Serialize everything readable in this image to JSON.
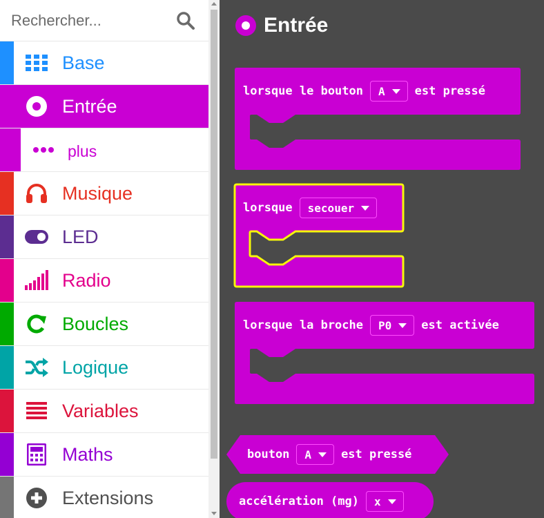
{
  "search": {
    "placeholder": "Rechercher..."
  },
  "categories": [
    {
      "label": "Base",
      "color": "#1e90ff",
      "icon": "grid-icon"
    },
    {
      "label": "Entrée",
      "color": "#c900d3",
      "icon": "target-icon"
    },
    {
      "label": "plus",
      "color": "#c900d3",
      "icon": "more-dots-icon"
    },
    {
      "label": "Musique",
      "color": "#e63022",
      "icon": "headphones-icon"
    },
    {
      "label": "LED",
      "color": "#5c2d91",
      "icon": "toggle-icon"
    },
    {
      "label": "Radio",
      "color": "#e3008c",
      "icon": "signal-bars-icon"
    },
    {
      "label": "Boucles",
      "color": "#00aa00",
      "icon": "loop-arrow-icon"
    },
    {
      "label": "Logique",
      "color": "#00a4a6",
      "icon": "shuffle-icon"
    },
    {
      "label": "Variables",
      "color": "#dc143c",
      "icon": "lines-icon"
    },
    {
      "label": "Maths",
      "color": "#9400d3",
      "icon": "calculator-icon"
    },
    {
      "label": "Extensions",
      "color": "#757575",
      "icon": "plus-circle-icon"
    }
  ],
  "flyout": {
    "title": "Entrée",
    "accent": "#c900d3",
    "blocks": {
      "button": {
        "prefix": "lorsque le bouton",
        "value": "A",
        "suffix": "est pressé"
      },
      "gesture": {
        "prefix": "lorsque",
        "value": "secouer"
      },
      "pin": {
        "prefix": "lorsque la broche",
        "value": "P0",
        "suffix": "est activée"
      },
      "pressed": {
        "prefix": "bouton",
        "value": "A",
        "suffix": "est pressé"
      },
      "accel": {
        "prefix": "accélération (mg)",
        "value": "x"
      }
    }
  }
}
